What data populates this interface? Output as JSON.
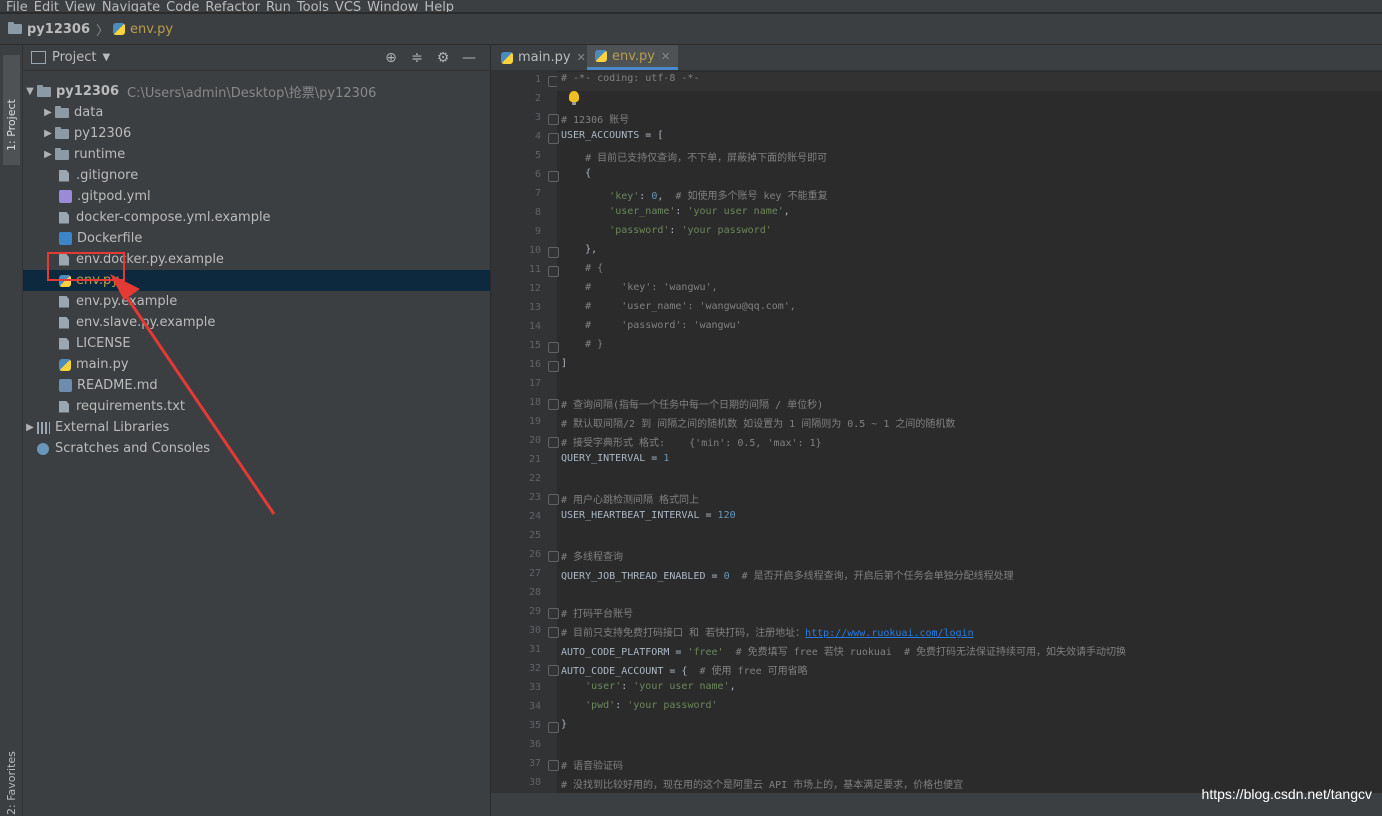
{
  "menu": [
    "File",
    "Edit",
    "View",
    "Navigate",
    "Code",
    "Refactor",
    "Run",
    "Tools",
    "VCS",
    "Window",
    "Help"
  ],
  "breadcrumb": {
    "project": "py12306",
    "file": "env.py"
  },
  "side_tabs": {
    "project": "1: Project",
    "favorites": "2: Favorites"
  },
  "project_panel": {
    "title": "Project",
    "tools": [
      "target-icon",
      "collapse-icon",
      "gear-icon",
      "minimize-icon"
    ]
  },
  "tree": [
    {
      "label": "py12306",
      "path": "C:\\Users\\admin\\Desktop\\抢票\\py12306",
      "type": "root",
      "expanded": true
    },
    {
      "label": "data",
      "type": "folder"
    },
    {
      "label": "py12306",
      "type": "folder"
    },
    {
      "label": "runtime",
      "type": "folder"
    },
    {
      "label": ".gitignore",
      "type": "file"
    },
    {
      "label": ".gitpod.yml",
      "type": "yml"
    },
    {
      "label": "docker-compose.yml.example",
      "type": "file"
    },
    {
      "label": "Dockerfile",
      "type": "docker"
    },
    {
      "label": "env.docker.py.example",
      "type": "file"
    },
    {
      "label": "env.py",
      "type": "py",
      "selected": true
    },
    {
      "label": "env.py.example",
      "type": "file"
    },
    {
      "label": "env.slave.py.example",
      "type": "file"
    },
    {
      "label": "LICENSE",
      "type": "file"
    },
    {
      "label": "main.py",
      "type": "py"
    },
    {
      "label": "README.md",
      "type": "md"
    },
    {
      "label": "requirements.txt",
      "type": "file"
    },
    {
      "label": "External Libraries",
      "type": "lib"
    },
    {
      "label": "Scratches and Consoles",
      "type": "scratch"
    }
  ],
  "tabs": [
    {
      "label": "main.py",
      "active": false
    },
    {
      "label": "env.py",
      "active": true
    }
  ],
  "code": [
    "# -*- coding: utf-8 -*-",
    "",
    "# 12306 账号",
    "USER_ACCOUNTS = [",
    "    # 目前已支持仅查询，不下单，屏蔽掉下面的账号即可",
    "    {",
    "        'key': 0,  # 如使用多个账号 key 不能重复",
    "        'user_name': 'your user name',",
    "        'password': 'your password'",
    "    },",
    "    # {",
    "    #     'key': 'wangwu',",
    "    #     'user_name': 'wangwu@qq.com',",
    "    #     'password': 'wangwu'",
    "    # }",
    "]",
    "",
    "# 查询间隔(指每一个任务中每一个日期的间隔 / 单位秒)",
    "# 默认取间隔/2 到 间隔之间的随机数 如设置为 1 间隔则为 0.5 ~ 1 之间的随机数",
    "# 接受字典形式 格式:    {'min': 0.5, 'max': 1}",
    "QUERY_INTERVAL = 1",
    "",
    "# 用户心跳检测间隔 格式同上",
    "USER_HEARTBEAT_INTERVAL = 120",
    "",
    "# 多线程查询",
    "QUERY_JOB_THREAD_ENABLED = 0  # 是否开启多线程查询，开启后第个任务会单独分配线程处理",
    "",
    "# 打码平台账号",
    "# 目前只支持免费打码接口 和 若快打码，注册地址：http://www.ruokuai.com/login",
    "AUTO_CODE_PLATFORM = 'free'  # 免费填写 free 若快 ruokuai  # 免费打码无法保证持续可用，如失效请手动切换",
    "AUTO_CODE_ACCOUNT = {  # 使用 free 可用省略",
    "    'user': 'your user name',",
    "    'pwd': 'your password'",
    "}",
    "",
    "# 语音验证码",
    "# 没找到比较好用的，现在用的这个是阿里云 API 市场上的，基本满足要求，价格也便宜"
  ],
  "watermark": "https://blog.csdn.net/tangcv",
  "colors": {
    "selection": "#0d293e",
    "annotation": "#e53935",
    "comment": "#808080",
    "string": "#6a8759",
    "number": "#6897bb",
    "active_tab_underline": "#4a88c7"
  }
}
